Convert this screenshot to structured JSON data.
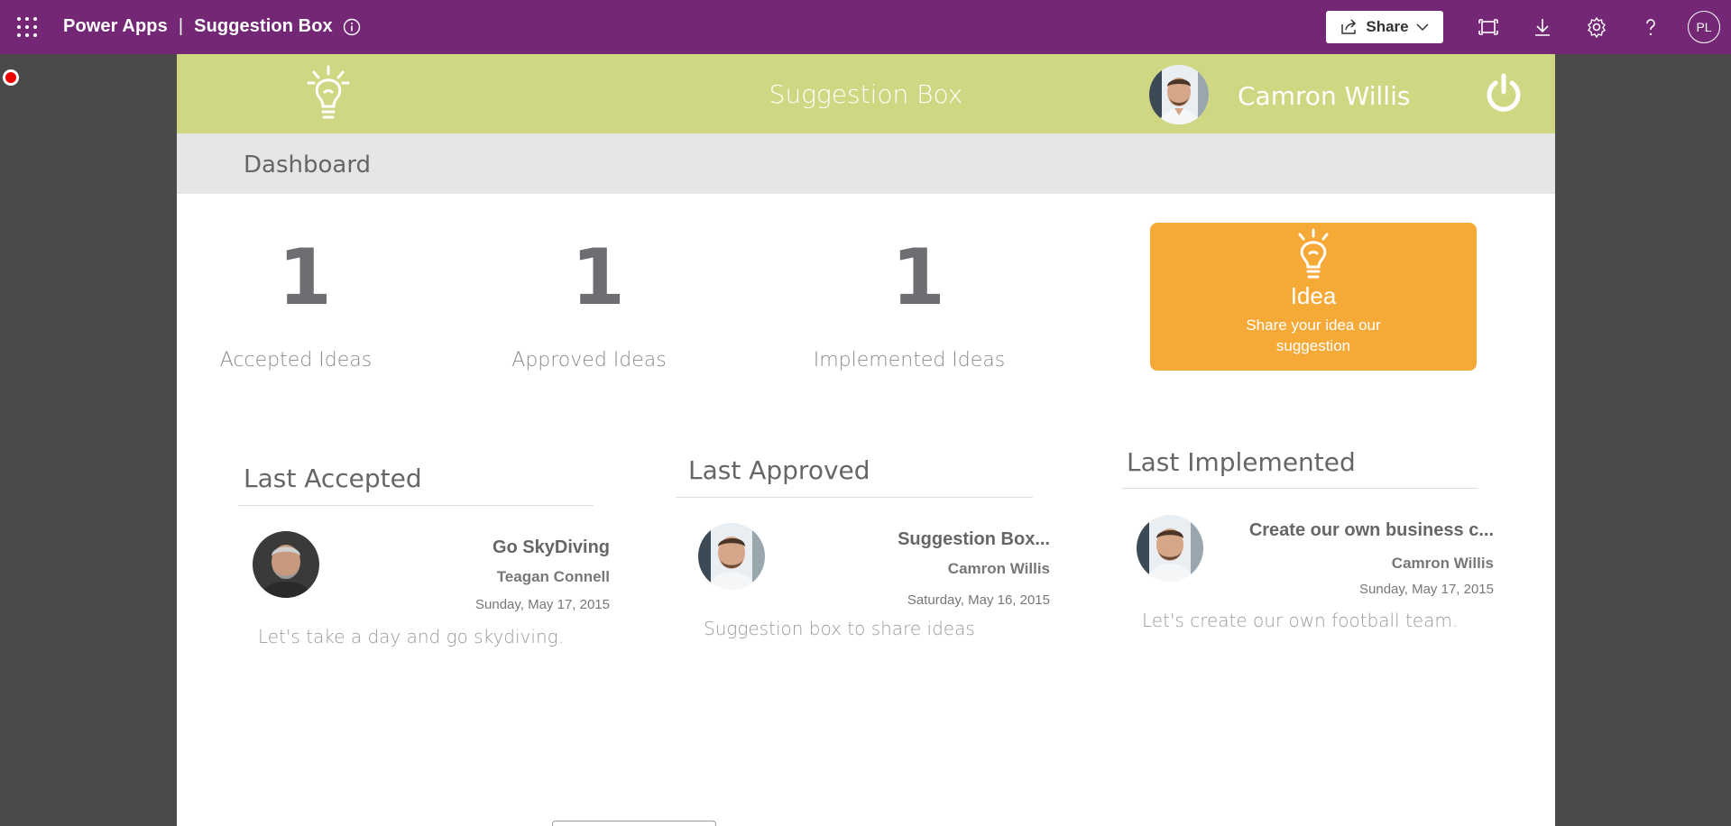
{
  "topbar": {
    "app_name": "Power Apps",
    "separator": "|",
    "app_title": "Suggestion Box",
    "share_label": "Share",
    "user_initials": "PL",
    "accent_color": "#742774"
  },
  "header": {
    "title": "Suggestion Box",
    "user_name": "Camron Willis",
    "color": "#cfd782"
  },
  "subheader": {
    "title": "Dashboard"
  },
  "stats": [
    {
      "value": "1",
      "label": "Accepted Ideas"
    },
    {
      "value": "1",
      "label": "Approved Ideas"
    },
    {
      "value": "1",
      "label": "Implemented Ideas"
    }
  ],
  "idea_card": {
    "title": "Idea",
    "subtitle": "Share your idea our suggestion",
    "color": "#f5a937"
  },
  "sections": [
    {
      "title": "Last Accepted",
      "item_title": "Go SkyDiving",
      "person": "Teagan Connell",
      "date": "Sunday, May 17, 2015",
      "description": "Let's take a day and go skydiving."
    },
    {
      "title": "Last Approved",
      "item_title": "Suggestion Box...",
      "person": "Camron Willis",
      "date": "Saturday, May 16, 2015",
      "description": "Suggestion box to share ideas"
    },
    {
      "title": "Last Implemented",
      "item_title": "Create our own business c...",
      "person": "Camron Willis",
      "date": "Sunday, May 17, 2015",
      "description": "Let's create our own football team."
    }
  ],
  "icons": {
    "waffle": "waffle-icon",
    "info": "info-icon",
    "share": "share-icon",
    "fit": "fit-to-screen-icon",
    "download": "download-icon",
    "settings": "gear-icon",
    "help": "help-icon",
    "bulb": "lightbulb-icon",
    "power": "power-icon"
  }
}
